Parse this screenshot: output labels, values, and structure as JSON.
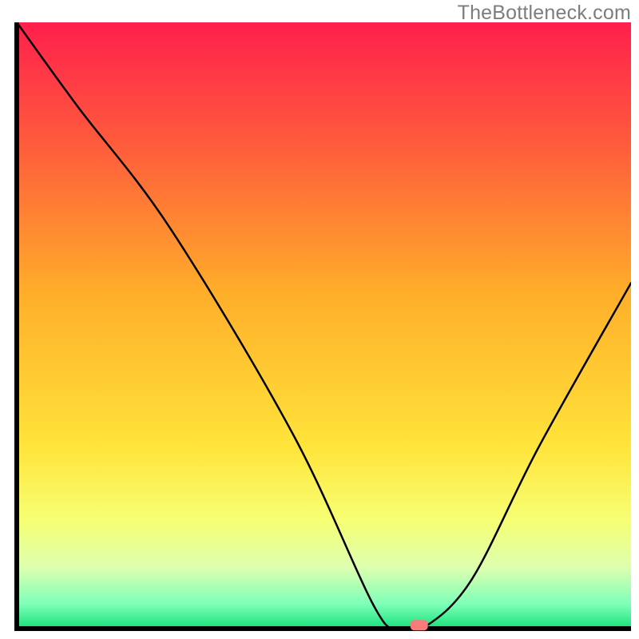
{
  "watermark": "TheBottleneck.com",
  "chart_data": {
    "type": "line",
    "title": "",
    "xlabel": "",
    "ylabel": "",
    "xlim": [
      0,
      100
    ],
    "ylim": [
      0,
      100
    ],
    "curve_x": [
      0,
      10,
      25,
      45,
      58,
      62,
      66,
      74,
      85,
      100
    ],
    "curve_y": [
      100,
      86,
      66,
      32,
      4,
      0,
      0,
      8,
      30,
      57
    ],
    "marker": {
      "x": 65.5,
      "y": 0.5,
      "color": "#f77b7b"
    },
    "gradient_stops": [
      {
        "pct": 0,
        "color": "#ff1f4d"
      },
      {
        "pct": 20,
        "color": "#ff5b3c"
      },
      {
        "pct": 45,
        "color": "#ffaf2a"
      },
      {
        "pct": 70,
        "color": "#ffe43a"
      },
      {
        "pct": 82,
        "color": "#f7ff73"
      },
      {
        "pct": 90,
        "color": "#dcffb0"
      },
      {
        "pct": 96,
        "color": "#7dffb8"
      },
      {
        "pct": 100,
        "color": "#16e07a"
      }
    ]
  }
}
